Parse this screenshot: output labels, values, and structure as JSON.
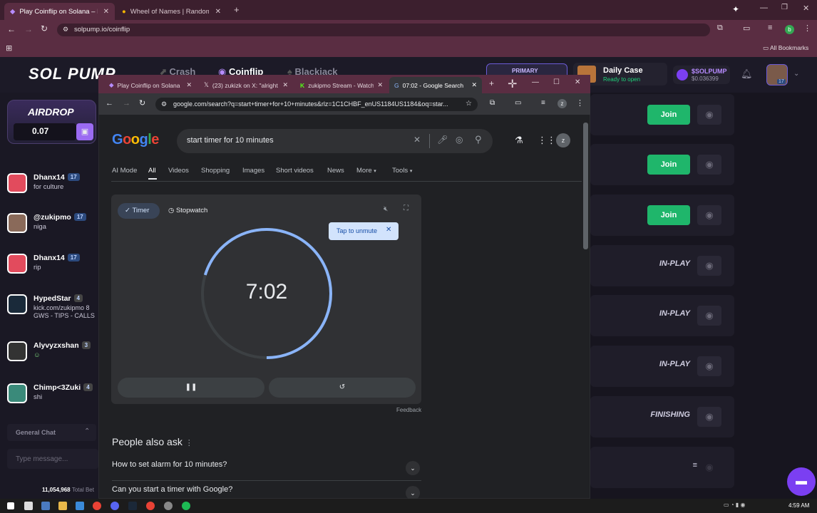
{
  "outer_browser": {
    "tabs": [
      {
        "label": "Play Coinflip on Solana – No K…",
        "active": true
      },
      {
        "label": "Wheel of Names | Random nam…",
        "active": false
      }
    ],
    "url": "solpump.io/coinflip",
    "bookmarks_label": "All Bookmarks",
    "profile_letter": "b"
  },
  "site": {
    "logo": "SOL PUMP",
    "nav": [
      "Crash",
      "Coinflip",
      "Blackjack"
    ],
    "primary_label": "PRIMARY",
    "daily_case": {
      "title": "Daily Case",
      "subtitle": "Ready to open"
    },
    "token": {
      "name": "$SOLPUMP",
      "value": "$0.036399"
    },
    "user_level": "17",
    "airdrop": {
      "label": "AIRDROP",
      "value": "0.07"
    },
    "chat": [
      {
        "name": "Dhanx14",
        "level": "17",
        "text": "for culture"
      },
      {
        "name": "@zukipmo",
        "level": "17",
        "text": "niga"
      },
      {
        "name": "Dhanx14",
        "level": "17",
        "text": "rip"
      },
      {
        "name": "HypedStar",
        "level": "4",
        "text": "kick.com/zukipmo 8 GWS - TIPS - CALLS"
      },
      {
        "name": "Alyvyzxshan",
        "level": "3",
        "text": ""
      },
      {
        "name": "Chimp<3Zuki",
        "level": "4",
        "text": "shi"
      }
    ],
    "general_chat": "General Chat",
    "chat_placeholder": "Type message...",
    "total_bet": "11,054,968",
    "total_bet_label": "Total Bet",
    "rows": [
      {
        "action": "Join"
      },
      {
        "action": "Join"
      },
      {
        "action": "Join"
      },
      {
        "status": "IN-PLAY"
      },
      {
        "status": "IN-PLAY"
      },
      {
        "status": "IN-PLAY"
      },
      {
        "status": "FINISHING"
      },
      {
        "status": "≡"
      }
    ]
  },
  "inner_browser": {
    "tabs": [
      {
        "label": "Play Coinflip on Solana",
        "active": false
      },
      {
        "label": "(23) zukizk on X: \"alright",
        "active": false
      },
      {
        "label": "zukipmo Stream - Watch",
        "active": false
      },
      {
        "label": "07:02 - Google Search",
        "active": true
      }
    ],
    "url": "google.com/search?q=start+timer+for+10+minutes&rlz=1C1CHBF_enUS1184US1184&oq=star...",
    "profile_letter": "z"
  },
  "google": {
    "logo": "Google",
    "query": "start timer for 10 minutes",
    "tabs": [
      "AI Mode",
      "All",
      "Videos",
      "Shopping",
      "Images",
      "Short videos",
      "News",
      "More",
      "Tools"
    ],
    "active_tab": "All",
    "timer": {
      "mode_timer": "Timer",
      "mode_stopwatch": "Stopwatch",
      "unmute_tip": "Tap to unmute",
      "display": "7:02",
      "progress_fraction": 0.297
    },
    "feedback": "Feedback",
    "paa_title": "People also ask",
    "questions": [
      "How to set alarm for 10 minutes?",
      "Can you start a timer with Google?"
    ]
  },
  "taskbar": {
    "time": "4:59 AM"
  },
  "colors": {
    "accent_green": "#1fb66b",
    "google_blue": "#8ab4f8",
    "chat_bubble": "#7b3ff2"
  }
}
